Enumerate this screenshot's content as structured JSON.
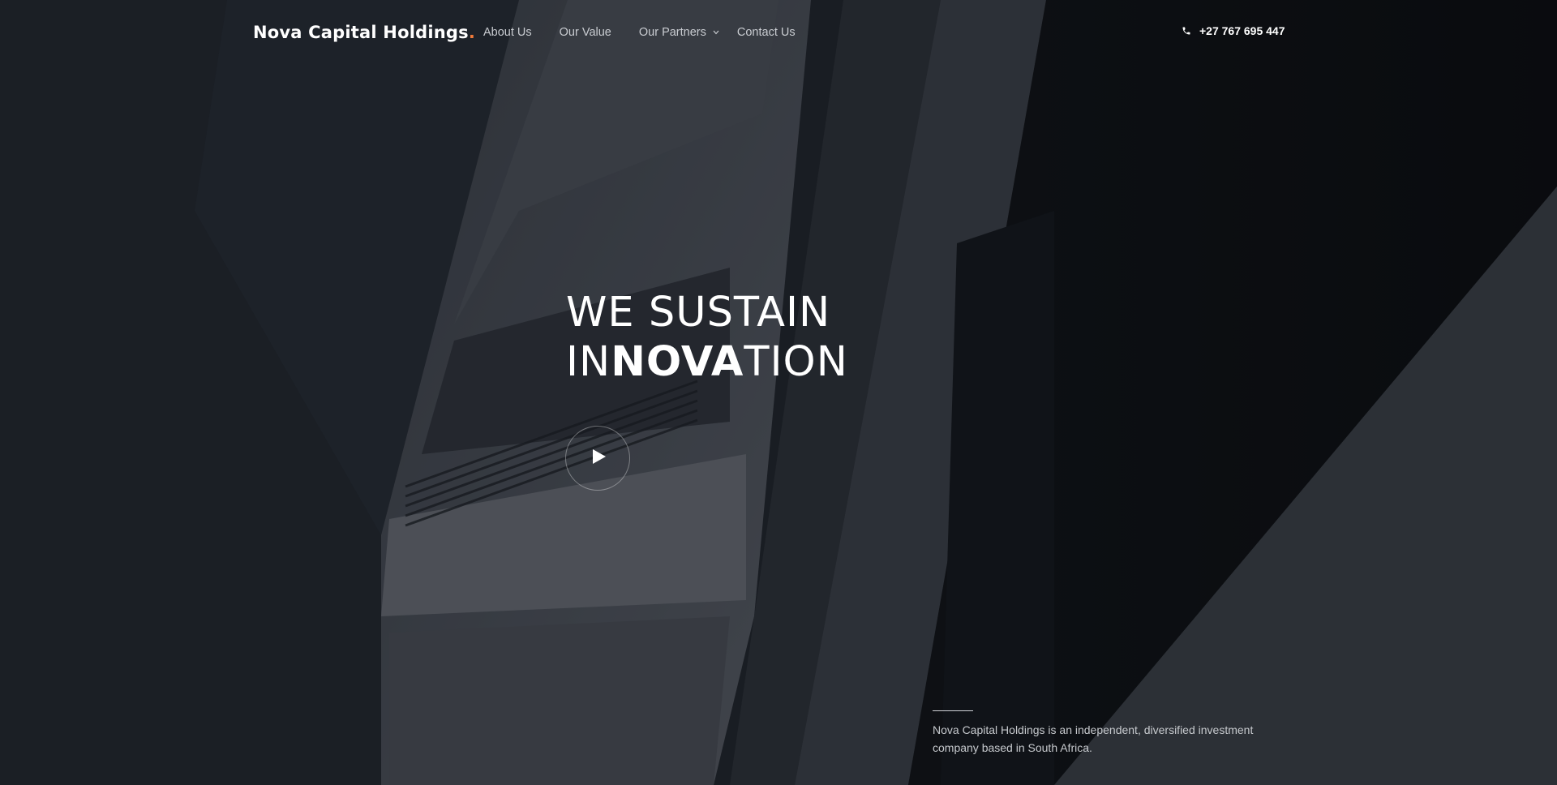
{
  "brand": {
    "name": "Nova Capital Holdings",
    "dot": "."
  },
  "nav": {
    "items": [
      {
        "label": "About Us"
      },
      {
        "label": "Our Value"
      },
      {
        "label": "Our Partners",
        "has_dropdown": true
      },
      {
        "label": "Contact Us"
      }
    ]
  },
  "phone": {
    "number": "+27 767 695 447",
    "icon": "phone-icon"
  },
  "hero": {
    "line1": "WE SUSTAIN",
    "line2_prefix": "IN",
    "line2_bold": "NOVA",
    "line2_suffix": "TION",
    "play_icon": "play-icon"
  },
  "about": {
    "text": "Nova Capital Holdings is an independent, diversified investment company based in South Africa."
  },
  "colors": {
    "accent": "#f07a3a",
    "background": "#1b1f25",
    "text": "#ffffff",
    "muted_text": "#c9ccd1"
  }
}
